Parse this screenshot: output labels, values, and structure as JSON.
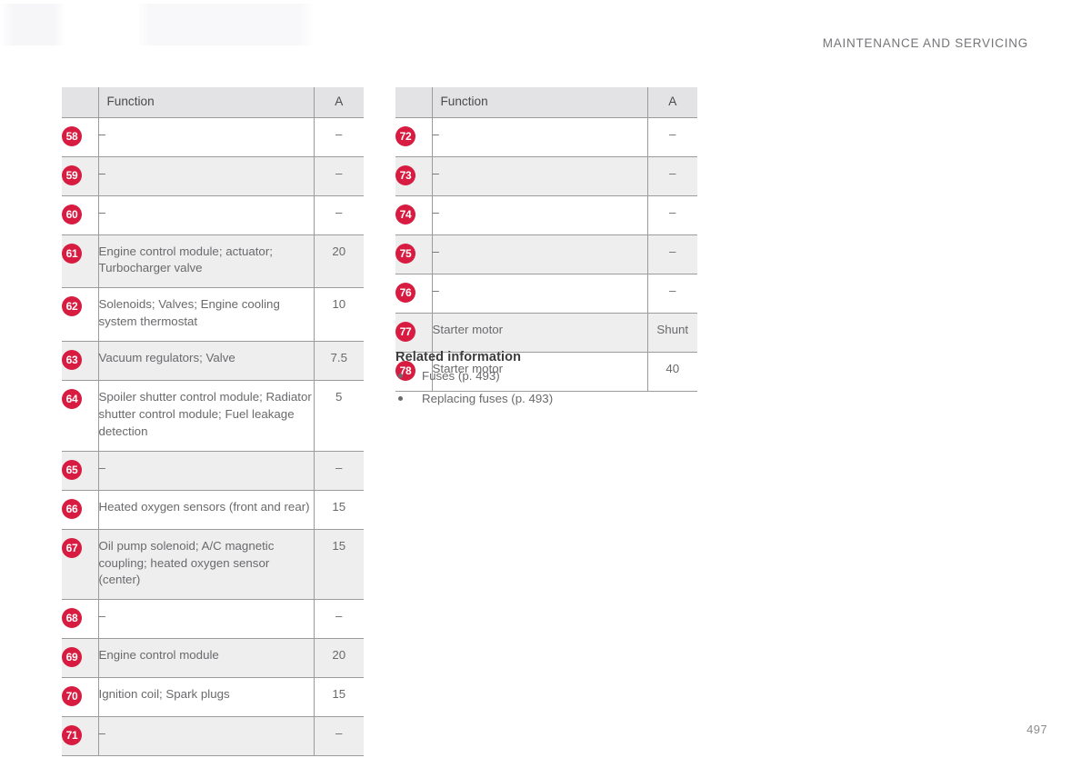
{
  "page": {
    "running_header": "MAINTENANCE AND SERVICING",
    "folio": "497"
  },
  "tables": [
    {
      "id": "fuse-table-left",
      "columns": [
        "",
        "Function",
        "A"
      ],
      "rows": [
        {
          "num": "58",
          "function": "–",
          "amps": "–"
        },
        {
          "num": "59",
          "function": "–",
          "amps": "–"
        },
        {
          "num": "60",
          "function": "–",
          "amps": "–"
        },
        {
          "num": "61",
          "function": "Engine control module; actuator; Turbocharger valve",
          "amps": "20"
        },
        {
          "num": "62",
          "function": "Solenoids; Valves; Engine cooling system thermostat",
          "amps": "10"
        },
        {
          "num": "63",
          "function": "Vacuum regulators; Valve",
          "amps": "7.5"
        },
        {
          "num": "64",
          "function": "Spoiler shutter control module; Radiator shutter control module; Fuel leakage detection",
          "amps": "5"
        },
        {
          "num": "65",
          "function": "–",
          "amps": "–"
        },
        {
          "num": "66",
          "function": "Heated oxygen sensors (front and rear)",
          "amps": "15"
        },
        {
          "num": "67",
          "function": "Oil pump solenoid; A/C magnetic coupling; heated oxygen sensor (center)",
          "amps": "15"
        },
        {
          "num": "68",
          "function": "–",
          "amps": "–"
        },
        {
          "num": "69",
          "function": "Engine control module",
          "amps": "20"
        },
        {
          "num": "70",
          "function": "Ignition coil; Spark plugs",
          "amps": "15"
        },
        {
          "num": "71",
          "function": "–",
          "amps": "–"
        }
      ]
    },
    {
      "id": "fuse-table-right",
      "columns": [
        "",
        "Function",
        "A"
      ],
      "rows": [
        {
          "num": "72",
          "function": "–",
          "amps": "–"
        },
        {
          "num": "73",
          "function": "–",
          "amps": "–"
        },
        {
          "num": "74",
          "function": "–",
          "amps": "–"
        },
        {
          "num": "75",
          "function": "–",
          "amps": "–"
        },
        {
          "num": "76",
          "function": "–",
          "amps": "–"
        },
        {
          "num": "77",
          "function": "Starter motor",
          "amps": "Shunt"
        },
        {
          "num": "78",
          "function": "Starter motor",
          "amps": "40"
        }
      ]
    }
  ],
  "related_information": {
    "title": "Related information",
    "links": [
      "Fuses (p. 493)",
      "Replacing fuses (p. 493)"
    ]
  },
  "colors": {
    "badge_red": "#d81c41",
    "header_fill": "#e3e3e5",
    "row_shade": "#eeeeef",
    "rule": "#9b9b9e",
    "body_text": "#6a6a6d"
  }
}
